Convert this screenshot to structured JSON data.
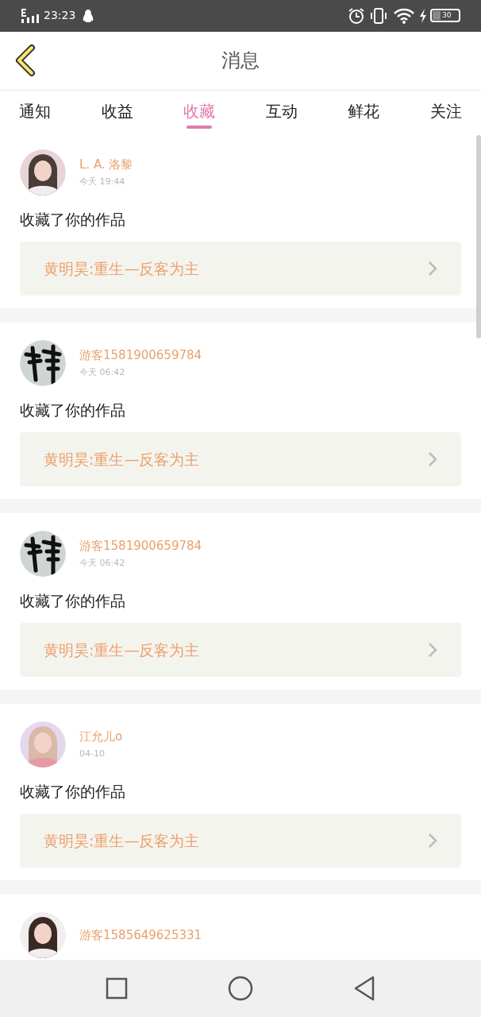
{
  "status_bar": {
    "time": "23:23",
    "battery": "30"
  },
  "header": {
    "title": "消息"
  },
  "tabs": [
    {
      "label": "通知",
      "selected": false
    },
    {
      "label": "收益",
      "selected": false
    },
    {
      "label": "收藏",
      "selected": true
    },
    {
      "label": "互动",
      "selected": false
    },
    {
      "label": "鲜花",
      "selected": false
    },
    {
      "label": "关注",
      "selected": false
    }
  ],
  "notifications": [
    {
      "name": "L. A. 洛黎",
      "time": "今天 19:44",
      "message": "收藏了你的作品",
      "work": "黄明昊:重生—反客为主"
    },
    {
      "name": "游客1581900659784",
      "time": "今天 06:42",
      "message": "收藏了你的作品",
      "work": "黄明昊:重生—反客为主"
    },
    {
      "name": "游客1581900659784",
      "time": "今天 06:42",
      "message": "收藏了你的作品",
      "work": "黄明昊:重生—反客为主"
    },
    {
      "name": "江允儿o",
      "time": "04-10",
      "message": "收藏了你的作品",
      "work": "黄明昊:重生—反客为主"
    },
    {
      "name": "游客1585649625331"
    }
  ]
}
